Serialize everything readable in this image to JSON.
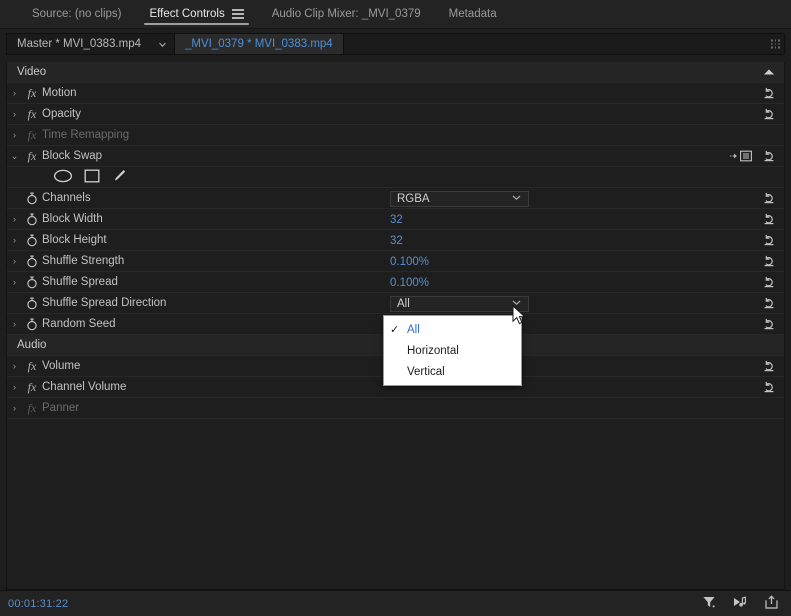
{
  "tabs": [
    {
      "label": "Source: (no clips)",
      "active": false,
      "menu": false
    },
    {
      "label": "Effect Controls",
      "active": true,
      "menu": true
    },
    {
      "label": "Audio Clip Mixer: _MVI_0379",
      "active": false,
      "menu": false
    },
    {
      "label": "Metadata",
      "active": false,
      "menu": false
    }
  ],
  "clipbar": {
    "master": "Master * MVI_0383.mp4",
    "chevron_icon": "chevron-down-icon",
    "selected": "_MVI_0379 * MVI_0383.mp4",
    "grip_icon": "resize-grip-icon"
  },
  "groups": {
    "video_label": "Video",
    "audio_label": "Audio"
  },
  "video_effects": [
    {
      "name": "Motion",
      "twisty": "›",
      "dim": false,
      "reset": true
    },
    {
      "name": "Opacity",
      "twisty": "›",
      "dim": false,
      "reset": true
    },
    {
      "name": "Time Remapping",
      "twisty": "›",
      "dim": true,
      "reset": false
    },
    {
      "name": "Block Swap",
      "twisty": "⌄",
      "dim": false,
      "reset": true
    }
  ],
  "shape_tools": [
    {
      "icon": "ellipse-mask-icon"
    },
    {
      "icon": "rectangle-mask-icon"
    },
    {
      "icon": "pen-mask-icon"
    }
  ],
  "params": [
    {
      "name": "Channels",
      "twisty": false,
      "type": "select",
      "value": "RGBA"
    },
    {
      "name": "Block Width",
      "twisty": true,
      "type": "number",
      "value": "32",
      "unit": ""
    },
    {
      "name": "Block Height",
      "twisty": true,
      "type": "number",
      "value": "32",
      "unit": ""
    },
    {
      "name": "Shuffle Strength",
      "twisty": true,
      "type": "number",
      "value": "0.100",
      "unit": "%"
    },
    {
      "name": "Shuffle Spread",
      "twisty": true,
      "type": "number",
      "value": "0.100",
      "unit": "%"
    },
    {
      "name": "Shuffle Spread Direction",
      "twisty": false,
      "type": "select",
      "value": "All"
    },
    {
      "name": "Random Seed",
      "twisty": true,
      "type": "number",
      "value": "",
      "unit": ""
    }
  ],
  "dropdown": {
    "open": true,
    "selected": "All",
    "options": [
      {
        "label": "All",
        "checked": true
      },
      {
        "label": "Horizontal",
        "checked": false
      },
      {
        "label": "Vertical",
        "checked": false
      }
    ]
  },
  "audio_effects": [
    {
      "name": "Volume",
      "twisty": "›",
      "dim": false,
      "reset": true
    },
    {
      "name": "Channel Volume",
      "twisty": "›",
      "dim": false,
      "reset": true
    },
    {
      "name": "Panner",
      "twisty": "›",
      "dim": true,
      "reset": false
    }
  ],
  "statusbar": {
    "timecode": "00:01:31:22",
    "icons": [
      {
        "name": "filter-funnel-icon"
      },
      {
        "name": "play-audio-icon"
      },
      {
        "name": "export-frame-icon"
      }
    ]
  },
  "colors": {
    "accent_blue": "#5a8fd0",
    "panel_bg": "#1e1e1e",
    "header_bg": "#232323",
    "popup_bg": "#ffffff"
  }
}
